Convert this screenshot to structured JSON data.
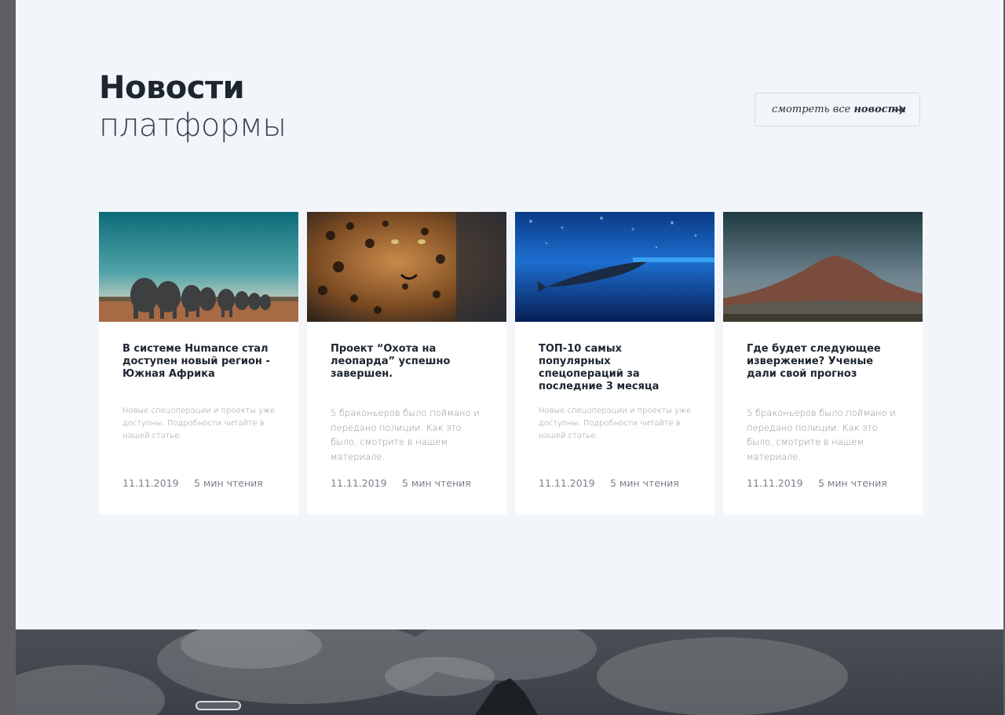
{
  "header": {
    "title_bold": "Новости",
    "title_light": "платформы",
    "view_all_prefix": "смотреть все ",
    "view_all_strong": "новости"
  },
  "cards": [
    {
      "image": "elephants",
      "title": "В системе Humance стал доступен новый регион - Южная Африка",
      "description": "Новые спецоперации и проекты уже доступны. Подробности читайте в нашей статье.",
      "date": "11.11.2019",
      "read_time": "5 мин чтения"
    },
    {
      "image": "leopard",
      "title": "Проект “Охота на леопарда” успешно завершен.",
      "description": "5 браконьеров было поймано и передано полиции. Как это было, смотрите в нашем материале.",
      "date": "11.11.2019",
      "read_time": "5 мин чтения"
    },
    {
      "image": "whale-shark",
      "title": "ТОП-10 самых популярных спецопераций за последние 3 месяца",
      "description": "Новые спецоперации и проекты уже доступны. Подробности читайте в нашей статье.",
      "date": "11.11.2019",
      "read_time": "5 мин чтения"
    },
    {
      "image": "volcano",
      "title": "Где будет следующее извержение? Ученые дали свой прогноз",
      "description": "5 браконьеров было поймано и передано полиции. Как это было, смотрите в нашем материале.",
      "date": "11.11.2019",
      "read_time": "5 мин чтения"
    }
  ],
  "colors": {
    "section_bg": "#f2f6fb",
    "heading": "#1d2530",
    "card_bg": "#ffffff",
    "muted_text": "#8a909a"
  }
}
